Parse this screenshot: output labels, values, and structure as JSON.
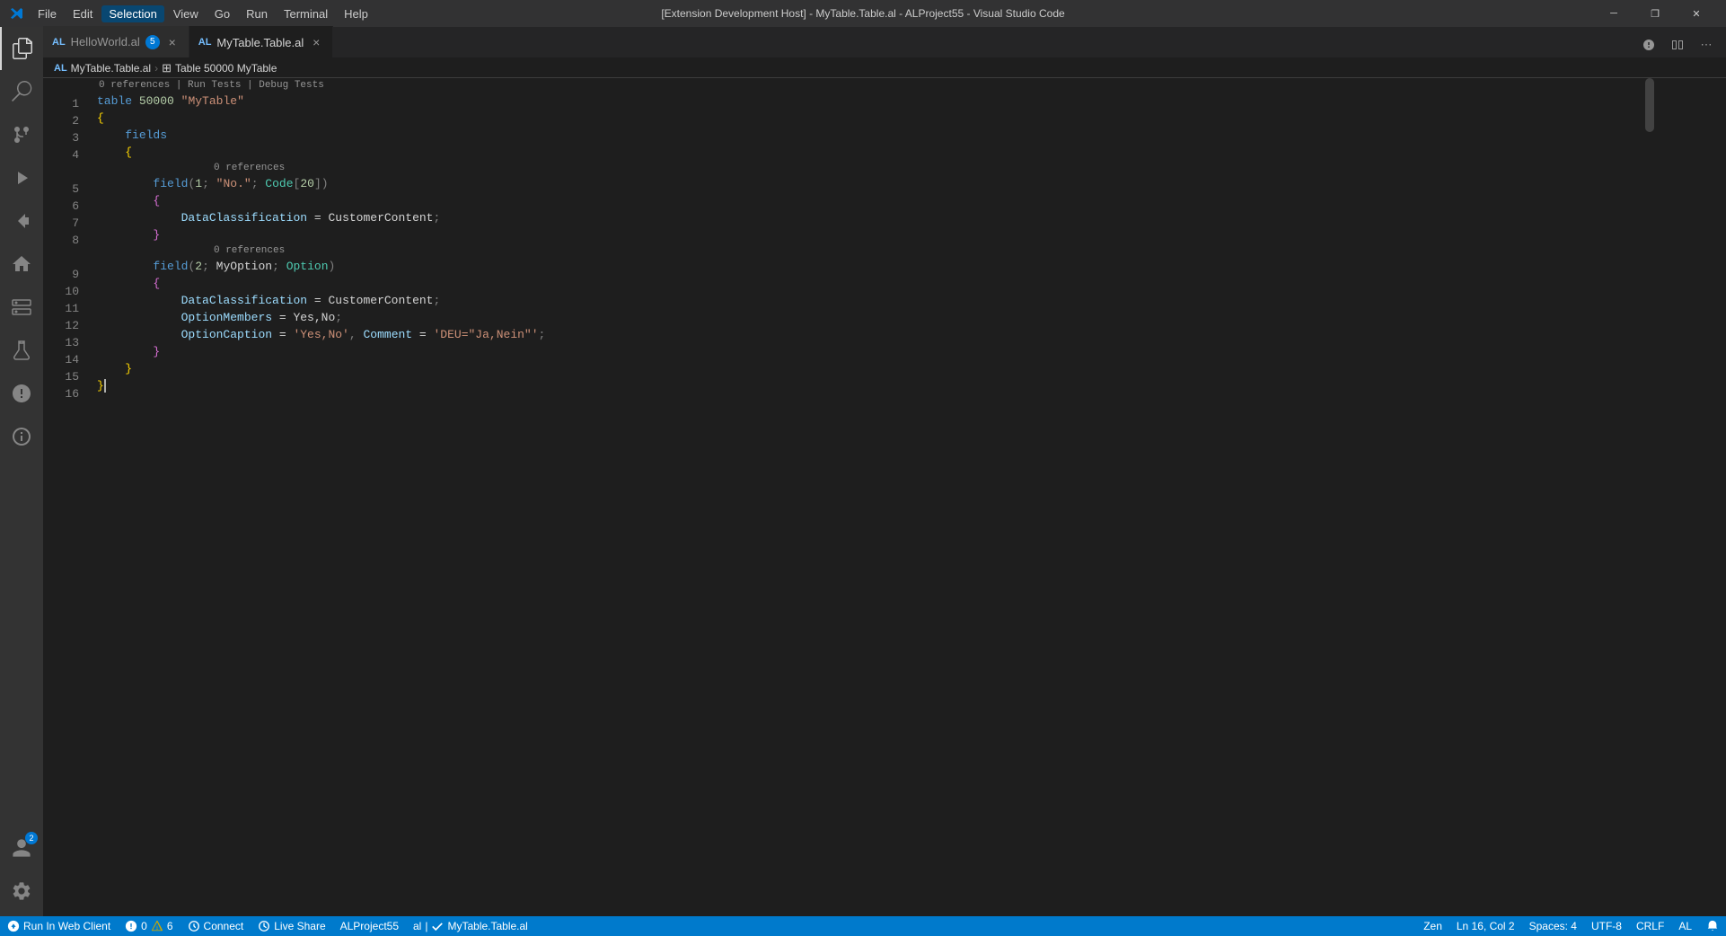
{
  "titleBar": {
    "title": "[Extension Development Host] - MyTable.Table.al - ALProject55 - Visual Studio Code",
    "menuItems": [
      "File",
      "Edit",
      "Selection",
      "View",
      "Go",
      "Run",
      "Terminal",
      "Help"
    ],
    "activeMenu": "Selection",
    "controls": {
      "minimize": "─",
      "restore": "❐",
      "close": "✕"
    }
  },
  "tabs": [
    {
      "lang": "AL",
      "name": "HelloWorld.al",
      "badge": "5",
      "active": false,
      "modified": false
    },
    {
      "lang": "AL",
      "name": "MyTable.Table.al",
      "active": true,
      "modified": false
    }
  ],
  "breadcrumb": {
    "file": "MyTable.Table.al",
    "icon": "table-icon",
    "path": "Table 50000 MyTable"
  },
  "editorHeader": {
    "lang": "AL",
    "file": "MyTable.Table.al",
    "breadIcon": "⊞",
    "separator": "›"
  },
  "codeLines": [
    {
      "num": 1,
      "content": "table",
      "type": "code"
    },
    {
      "num": 2,
      "content": "{",
      "type": "code"
    },
    {
      "num": 3,
      "content": "    fields",
      "type": "code"
    },
    {
      "num": 4,
      "content": "    {",
      "type": "code"
    },
    {
      "num": 5,
      "content": "        field(1; \"No.\"; Code[20])",
      "type": "code"
    },
    {
      "num": 6,
      "content": "        {",
      "type": "code"
    },
    {
      "num": 7,
      "content": "            DataClassification = CustomerContent;",
      "type": "code"
    },
    {
      "num": 8,
      "content": "        }",
      "type": "code"
    },
    {
      "num": 9,
      "content": "        field(2; MyOption; Option)",
      "type": "code"
    },
    {
      "num": 10,
      "content": "        {",
      "type": "code"
    },
    {
      "num": 11,
      "content": "            DataClassification = CustomerContent;",
      "type": "code"
    },
    {
      "num": 12,
      "content": "            OptionMembers = Yes,No;",
      "type": "code"
    },
    {
      "num": 13,
      "content": "            OptionCaption = 'Yes,No', Comment = 'DEU=\"Ja,Nein\"';",
      "type": "code"
    },
    {
      "num": 14,
      "content": "        }",
      "type": "code"
    },
    {
      "num": 15,
      "content": "    }",
      "type": "code"
    },
    {
      "num": 16,
      "content": "}",
      "type": "code"
    }
  ],
  "statusBar": {
    "branch": "Run In Web Client",
    "errors": "0",
    "warnings": "6",
    "connect": "Connect",
    "liveShare": "Live Share",
    "project": "ALProject55",
    "al": "al",
    "file": "MyTable.Table.al",
    "zen": "Zen",
    "position": "Ln 16, Col 2",
    "spaces": "Spaces: 4",
    "encoding": "UTF-8",
    "lineEnding": "CRLF",
    "language": "AL"
  },
  "activityBar": {
    "icons": [
      {
        "name": "explorer-icon",
        "label": "Explorer",
        "active": true
      },
      {
        "name": "search-icon",
        "label": "Search",
        "active": false
      },
      {
        "name": "source-control-icon",
        "label": "Source Control",
        "active": false
      },
      {
        "name": "run-debug-icon",
        "label": "Run and Debug",
        "active": false
      },
      {
        "name": "extensions-icon",
        "label": "Extensions",
        "active": false
      },
      {
        "name": "al-icon",
        "label": "AL Home",
        "active": false
      },
      {
        "name": "remote-icon",
        "label": "Remote Explorer",
        "active": false
      },
      {
        "name": "testing-icon",
        "label": "Testing",
        "active": false
      },
      {
        "name": "diagnostics-icon",
        "label": "AL App Diagnostics",
        "active": false
      },
      {
        "name": "info-icon",
        "label": "AL Variable Info",
        "active": false
      }
    ],
    "bottomIcons": [
      {
        "name": "account-icon",
        "label": "Account",
        "badge": "2"
      },
      {
        "name": "settings-icon",
        "label": "Settings"
      }
    ]
  }
}
